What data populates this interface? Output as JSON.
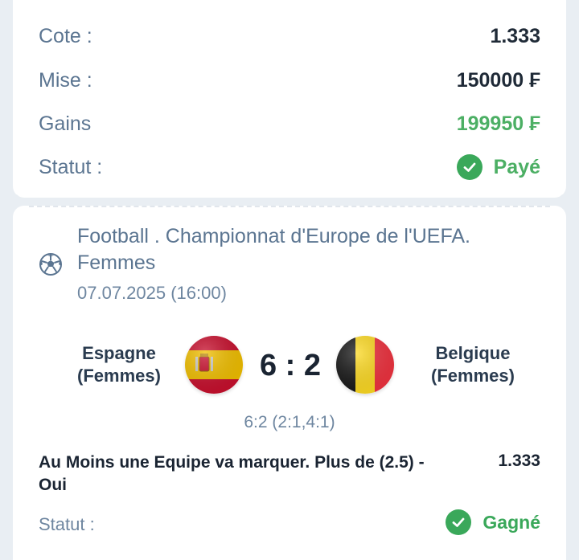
{
  "summary": {
    "odds_label": "Cote :",
    "odds_value": "1.333",
    "stake_label": "Mise :",
    "stake_value": "150000 ₣",
    "winnings_label": "Gains",
    "winnings_value": "199950 ₣",
    "status_label": "Statut :",
    "status_value": "Payé"
  },
  "event": {
    "sport_icon": "football-icon",
    "league": "Football . Championnat d'Europe de l'UEFA. Femmes",
    "datetime": "07.07.2025 (16:00)",
    "home_team": "Espagne (Femmes)",
    "away_team": "Belgique (Femmes)",
    "home_flag": "spain-flag-icon",
    "away_flag": "belgium-flag-icon",
    "score": "6 : 2",
    "score_detail": "6:2 (2:1,4:1)"
  },
  "bet": {
    "selection": "Au Moins une Equipe va marquer. Plus de (2.5) - Oui",
    "odds": "1.333",
    "status_label": "Statut :",
    "status_value": "Gagné"
  },
  "colors": {
    "green": "#3aa85a",
    "label": "#5b7591",
    "text_dark": "#1a2432"
  }
}
